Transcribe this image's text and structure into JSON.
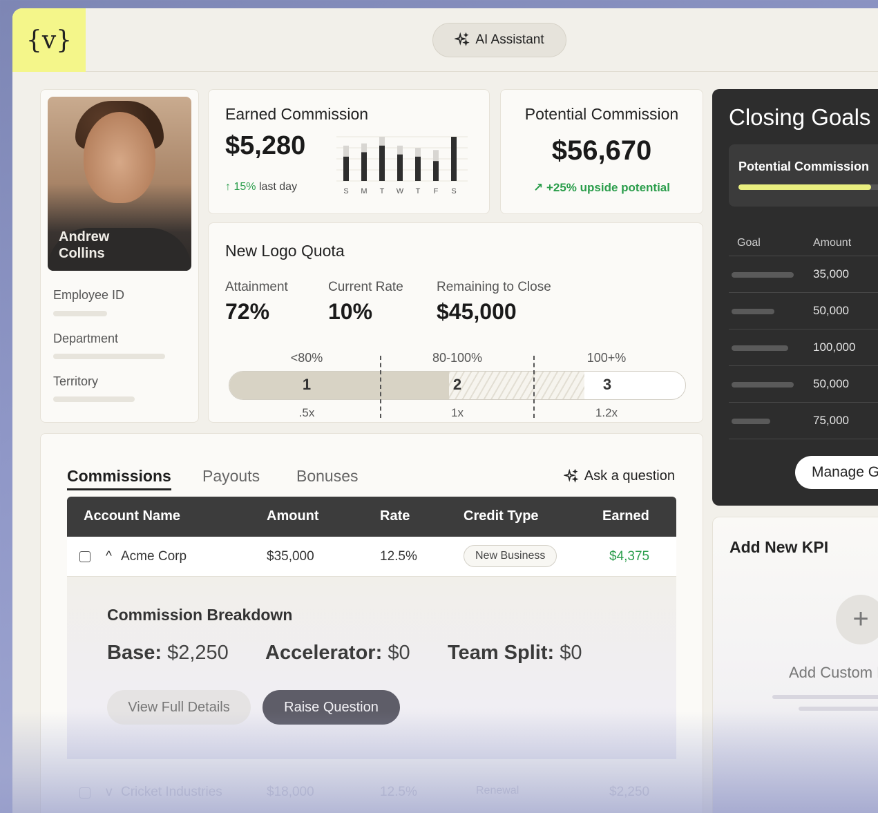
{
  "app": {
    "logo_text": "{v}",
    "ai_button_label": "AI Assistant",
    "accent_color": "#f4f68a"
  },
  "profile": {
    "name_first": "Andrew",
    "name_last": "Collins",
    "fields": [
      "Employee ID",
      "Department",
      "Territory"
    ]
  },
  "earned": {
    "title": "Earned Commission",
    "value": "$5,280",
    "trend_pct": "15%",
    "trend_text": "last day",
    "chart_data": {
      "type": "bar",
      "categories": [
        "S",
        "M",
        "T",
        "W",
        "T",
        "F",
        "S"
      ],
      "series": [
        {
          "values": [
            0.55,
            0.65,
            0.8,
            0.6,
            0.55,
            0.45,
            1.0
          ]
        },
        {
          "values": [
            0.8,
            0.85,
            1.0,
            0.8,
            0.75,
            0.7,
            1.0
          ]
        }
      ]
    }
  },
  "potential": {
    "title": "Potential Commission",
    "value": "$56,670",
    "sub": "+25% upside potential"
  },
  "quota": {
    "title": "New Logo Quota",
    "attainment_label": "Attainment",
    "attainment_value": "72%",
    "rate_label": "Current Rate",
    "rate_value": "10%",
    "remaining_label": "Remaining to Close",
    "remaining_value": "$45,000",
    "tiers": [
      {
        "range": "<80%",
        "num": "1",
        "mult": ".5x"
      },
      {
        "range": "80-100%",
        "num": "2",
        "mult": "1x"
      },
      {
        "range": "100+%",
        "num": "3",
        "mult": "1.2x"
      }
    ],
    "progress": 0.72
  },
  "tabs": {
    "items": [
      "Commissions",
      "Payouts",
      "Bonuses"
    ],
    "active": "Commissions",
    "ask_label": "Ask a question"
  },
  "table": {
    "headers": [
      "Account Name",
      "Amount",
      "Rate",
      "Credit Type",
      "Earned"
    ],
    "rows": [
      {
        "account": "Acme Corp",
        "amount": "$35,000",
        "rate": "12.5%",
        "type": "New Business",
        "earned": "$4,375"
      },
      {
        "account": "Cricket Industries",
        "amount": "$18,000",
        "rate": "12.5%",
        "type": "Renewal",
        "earned": "$2,250"
      }
    ]
  },
  "breakdown": {
    "title": "Commission Breakdown",
    "base_label": "Base:",
    "base_value": "$2,250",
    "accel_label": "Accelerator:",
    "accel_value": "$0",
    "split_label": "Team Split:",
    "split_value": "$0",
    "view_label": "View Full Details",
    "raise_label": "Raise Question"
  },
  "goals": {
    "title": "Closing Goals",
    "potential_label": "Potential Commission",
    "potential_progress": 0.8,
    "headers": [
      "Goal",
      "Amount"
    ],
    "amounts": [
      "35,000",
      "50,000",
      "100,000",
      "50,000",
      "75,000"
    ],
    "manage_label": "Manage Goals"
  },
  "kpi": {
    "title": "Add New KPI",
    "add_label": "Add Custom KPI"
  }
}
